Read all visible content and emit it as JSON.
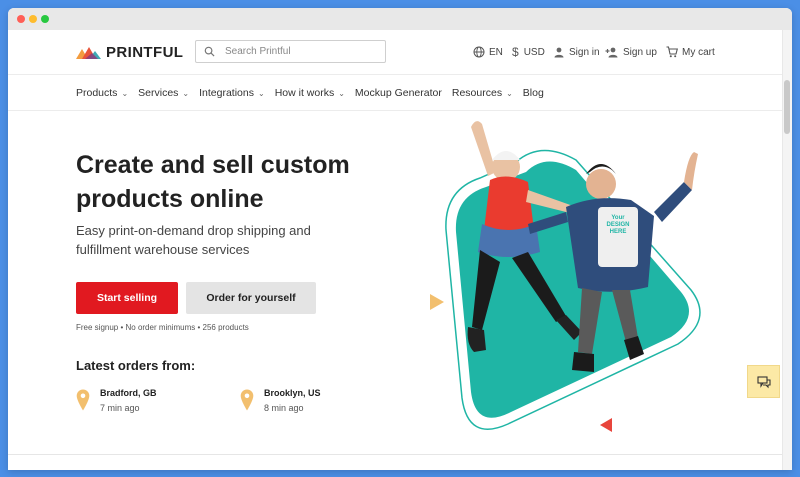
{
  "brand": {
    "name": "PRINTFUL"
  },
  "search": {
    "placeholder": "Search Printful"
  },
  "topbar": {
    "language": "EN",
    "currency": "USD",
    "sign_in": "Sign in",
    "sign_up": "Sign up",
    "cart": "My cart"
  },
  "nav": {
    "items": [
      {
        "label": "Products",
        "chevron": true
      },
      {
        "label": "Services",
        "chevron": true
      },
      {
        "label": "Integrations",
        "chevron": true
      },
      {
        "label": "How it works",
        "chevron": true
      },
      {
        "label": "Mockup Generator",
        "chevron": false
      },
      {
        "label": "Resources",
        "chevron": true
      },
      {
        "label": "Blog",
        "chevron": false
      }
    ]
  },
  "hero": {
    "title_line1": "Create and sell custom",
    "title_line2": "products online",
    "subtitle_line1": "Easy print-on-demand drop shipping and",
    "subtitle_line2": "fulfillment warehouse services",
    "primary_button": "Start selling",
    "secondary_button": "Order for yourself",
    "fineprint": "Free signup • No order minimums • 256 products",
    "shirt_text": "Your DESIGN HERE"
  },
  "orders": {
    "title": "Latest orders from:",
    "items": [
      {
        "city": "Bradford, GB",
        "time": "7 min ago"
      },
      {
        "city": "Brooklyn, US",
        "time": "8 min ago"
      }
    ]
  },
  "colors": {
    "accent_red": "#e11920",
    "teal": "#1fb5a5",
    "pin": "#f2bf6e",
    "chat_bg": "#fce9a6",
    "window_bg": "#4b8fe6"
  }
}
